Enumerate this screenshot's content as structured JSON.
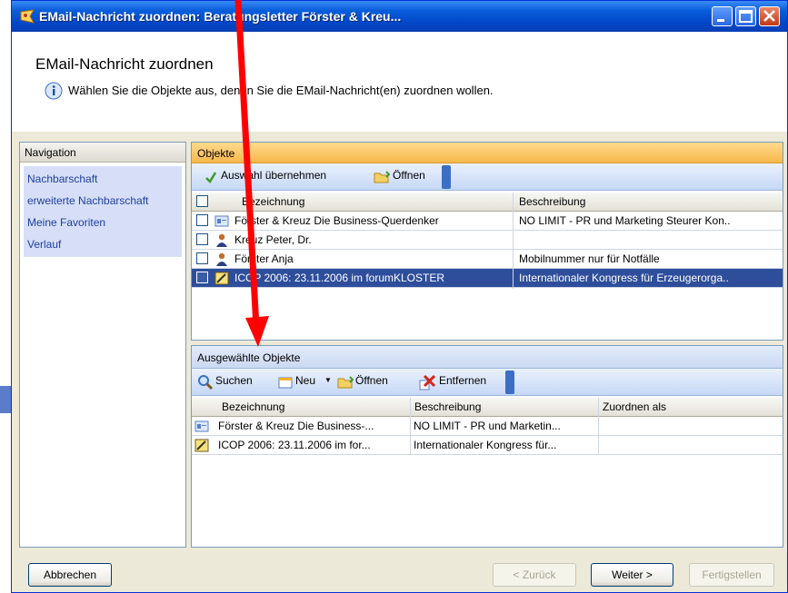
{
  "window_title": "EMail-Nachricht zuordnen: Beratungsletter Förster & Kreu...",
  "header": {
    "title": "EMail-Nachricht zuordnen",
    "subtitle": "Wählen Sie die Objekte aus, denen Sie die EMail-Nachricht(en) zuordnen wollen."
  },
  "navigation": {
    "title": "Navigation",
    "items": [
      "Nachbarschaft",
      "erweiterte Nachbarschaft",
      "Meine Favoriten",
      "Verlauf"
    ]
  },
  "objekte": {
    "title": "Objekte",
    "toolbar": {
      "select_label": "Auswahl übernehmen",
      "open_label": "Öffnen"
    },
    "columns": [
      "Bezeichnung",
      "Beschreibung"
    ],
    "rows": [
      {
        "icon": "contact-card-icon",
        "name": "Förster & Kreuz Die Business-Querdenker",
        "desc": "NO LIMIT - PR und Marketing Steurer Kon..",
        "selected": false
      },
      {
        "icon": "person-icon",
        "name": "Kreuz Peter, Dr.",
        "desc": "",
        "selected": false
      },
      {
        "icon": "person-icon",
        "name": "Förster Anja",
        "desc": "Mobilnummer nur für Notfälle",
        "selected": false
      },
      {
        "icon": "note-icon",
        "name": "ICOP 2006: 23.11.2006 im forumKLOSTER",
        "desc": "Internationaler Kongress für Erzeugerorga..",
        "selected": true
      }
    ]
  },
  "ausgewaehlte": {
    "title": "Ausgewählte Objekte",
    "toolbar": {
      "search_label": "Suchen",
      "new_label": "Neu",
      "open_label": "Öffnen",
      "remove_label": "Entfernen"
    },
    "columns": [
      "Bezeichnung",
      "Beschreibung",
      "Zuordnen als"
    ],
    "rows": [
      {
        "icon": "contact-card-icon",
        "name": "Förster & Kreuz Die Business-...",
        "desc": "NO LIMIT - PR und Marketin...",
        "assign": ""
      },
      {
        "icon": "note-icon",
        "name": "ICOP 2006: 23.11.2006 im for...",
        "desc": "Internationaler Kongress für...",
        "assign": ""
      }
    ]
  },
  "footer": {
    "cancel": "Abbrechen",
    "back": "< Zurück",
    "next": "Weiter >",
    "finish": "Fertigstellen"
  },
  "colors": {
    "title_bar": "#0a5fdc",
    "objekte_header": "#f7b84a",
    "selected_row": "#2e4e9b",
    "annotation_arrow": "#ff0000"
  }
}
